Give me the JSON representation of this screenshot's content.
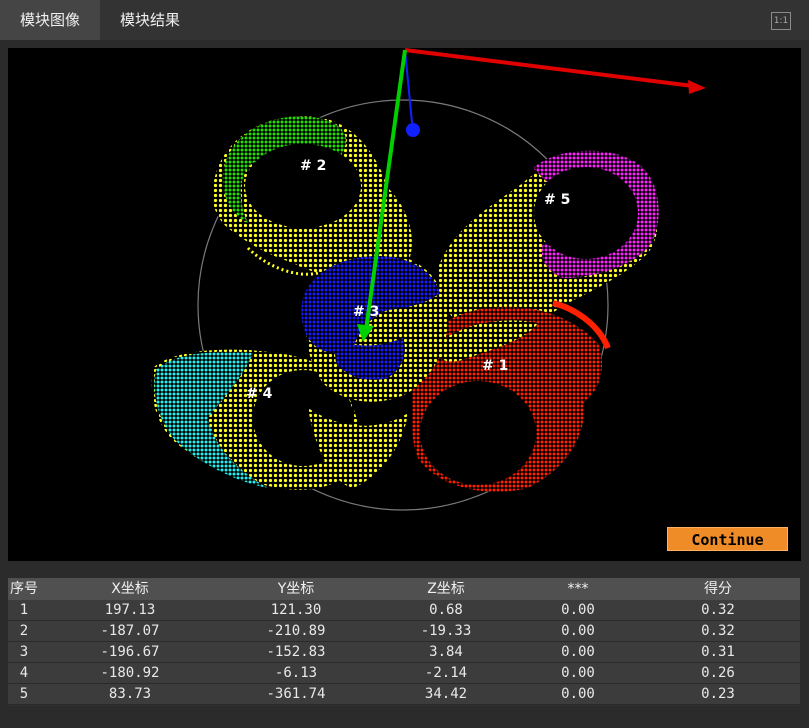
{
  "tabs": [
    {
      "label": "模块图像"
    },
    {
      "label": "模块结果"
    }
  ],
  "ratio_button": "1:1",
  "viewport": {
    "part_labels": [
      "# 1",
      "# 2",
      "# 3",
      "# 4",
      "# 5"
    ],
    "colors": {
      "axis_x": "#e00000",
      "axis_y": "#00d000",
      "axis_z": "#1020ff",
      "part_1": "#ff2000",
      "part_2": "#22e000",
      "part_3": "#1a1aff",
      "part_4": "#20f0f0",
      "part_5": "#ff20ff",
      "overlap": "#ffff20"
    }
  },
  "continue_button": "Continue",
  "table": {
    "headers": [
      "序号",
      "X坐标",
      "Y坐标",
      "Z坐标",
      "***",
      "得分"
    ],
    "rows": [
      [
        "1",
        "197.13",
        "121.30",
        "0.68",
        "0.00",
        "0.32"
      ],
      [
        "2",
        "-187.07",
        "-210.89",
        "-19.33",
        "0.00",
        "0.32"
      ],
      [
        "3",
        "-196.67",
        "-152.83",
        "3.84",
        "0.00",
        "0.31"
      ],
      [
        "4",
        "-180.92",
        "-6.13",
        "-2.14",
        "0.00",
        "0.26"
      ],
      [
        "5",
        "83.73",
        "-361.74",
        "34.42",
        "0.00",
        "0.23"
      ]
    ]
  }
}
